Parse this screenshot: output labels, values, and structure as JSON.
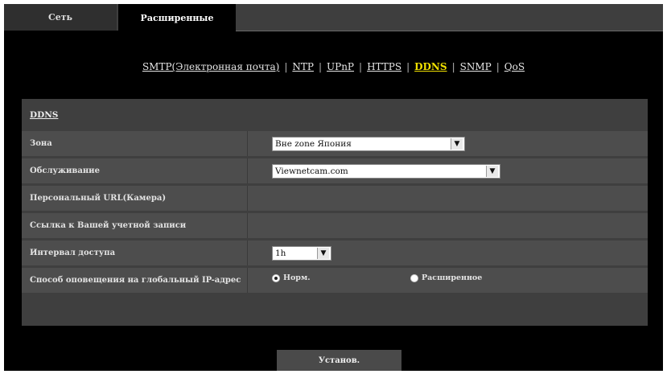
{
  "tabs": [
    {
      "label": "Сеть",
      "active": false
    },
    {
      "label": "Расширенные",
      "active": true
    }
  ],
  "subnav": [
    {
      "label": "SMTP(Электронная почта)",
      "active": false
    },
    {
      "label": "NTP",
      "active": false
    },
    {
      "label": "UPnP",
      "active": false
    },
    {
      "label": "HTTPS",
      "active": false
    },
    {
      "label": "DDNS",
      "active": true
    },
    {
      "label": "SNMP",
      "active": false
    },
    {
      "label": "QoS",
      "active": false
    }
  ],
  "panel": {
    "title": "DDNS",
    "rows": {
      "zone": {
        "label": "Зона",
        "value": "Вне zone Япония"
      },
      "service": {
        "label": "Обслуживание",
        "value": "Viewnetcam.com"
      },
      "personal_url": {
        "label": "Персональный URL(Камера)"
      },
      "account_link": {
        "label": "Ссылка к Вашей учетной записи"
      },
      "access_interval": {
        "label": "Интервал доступа",
        "value": "1h"
      },
      "ip_notify": {
        "label": "Способ оповещения на глобальный IP-адрес",
        "options": [
          "Норм.",
          "Расширенное"
        ],
        "selected": "Норм."
      }
    }
  },
  "set_button": {
    "label": "Установ."
  }
}
